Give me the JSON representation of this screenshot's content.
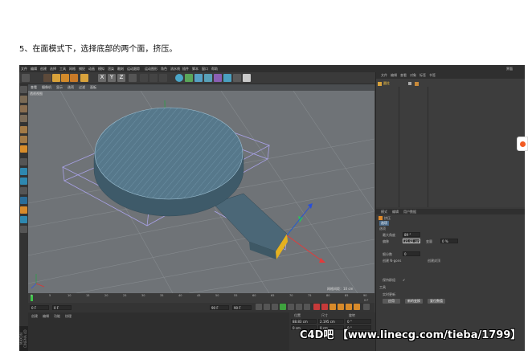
{
  "step_text": "5、在面模式下，选择底部的两个面，挤压。",
  "app": {
    "menus": [
      "文件",
      "编辑",
      "创建",
      "选择",
      "工具",
      "网格",
      "捕捉",
      "动画",
      "模拟",
      "渲染",
      "雕刻",
      "运动跟踪",
      "运动图形",
      "角色",
      "流水线",
      "插件",
      "脚本",
      "窗口",
      "帮助"
    ],
    "layout_label": "界面",
    "viewport_menus": [
      "查看",
      "摄像机",
      "显示",
      "选项",
      "过滤",
      "面板"
    ],
    "viewport_name": "透视视图",
    "grid_spacing": "网格间距：10 cm",
    "timeline_ticks": [
      "0",
      "5",
      "10",
      "15",
      "20",
      "25",
      "30",
      "35",
      "40",
      "45",
      "50",
      "55",
      "60",
      "65",
      "70",
      "75",
      "80",
      "85",
      "90"
    ],
    "frame_start": "0 F",
    "frame_current": "0 F",
    "frame_end": "90 F",
    "frame_end2": "90 F",
    "frame_indicator": "0 F",
    "material_tabs": [
      "创建",
      "编辑",
      "功能",
      "纹理"
    ],
    "coord_headers": [
      "位置",
      "尺寸",
      "旋转"
    ],
    "coord_values": {
      "x_pos": "88.83 cm",
      "x_size": "2.195 cm",
      "h_rot": "0 °",
      "y_pos": "0 cm",
      "z_size": "0 cm",
      "b_rot": "0 °"
    },
    "right_tabs": [
      "文件",
      "编辑",
      "查看",
      "对象",
      "标签",
      "书签"
    ],
    "object_name": "圆柱",
    "attr_tabs": [
      "模式",
      "编辑",
      "用户数据"
    ],
    "attr_object": "挤压",
    "attr_section": "选项",
    "attr_subsection": "选项",
    "attr_fields": [
      {
        "label": "最大角度",
        "value": "89 °"
      },
      {
        "label": "偏移",
        "value": "35.82 cm"
      },
      {
        "label": "变量",
        "value": "0 %"
      },
      {
        "label": "细分数",
        "value": "0"
      },
      {
        "label": "创建 N-gons",
        "value": ""
      },
      {
        "label": "创建封顶",
        "value": ""
      },
      {
        "label": "保持群组",
        "value": "✓"
      }
    ],
    "tool_section": "工具",
    "realtime_label": "实时更新",
    "buttons": [
      "应用",
      "新的变换",
      "复位数值"
    ],
    "preset_label": "预设",
    "maxon_label": "MAXON CINEMA 4D"
  },
  "watermark": "C4D吧 【www.linecg.com/tieba/1799】",
  "colors": {
    "mesh": "#4d6f80",
    "selected_faces": "#5c85a0",
    "grid": "#808589",
    "bbox": "#a9a2e8",
    "accent": "#f0a030"
  }
}
